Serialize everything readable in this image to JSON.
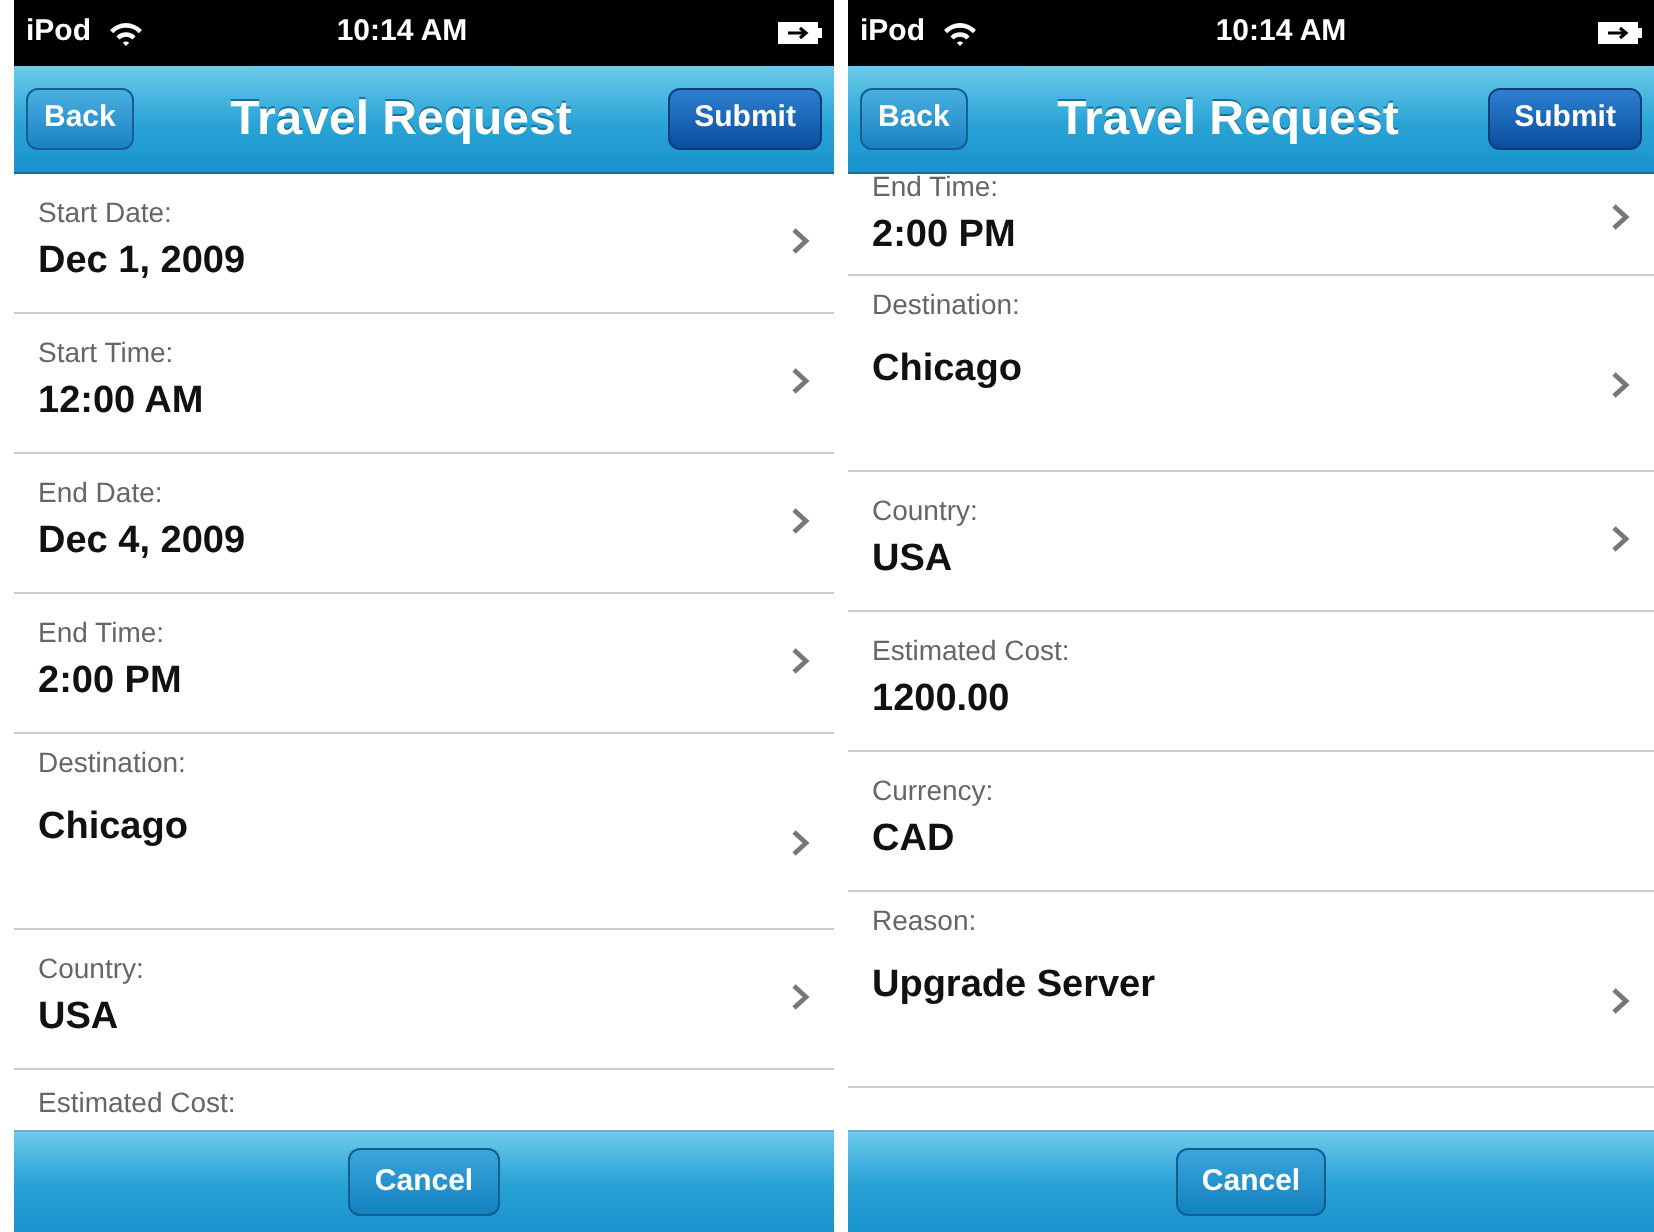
{
  "screens": [
    {
      "status": {
        "carrier": "iPod",
        "time": "10:14 AM"
      },
      "nav": {
        "back": "Back",
        "title": "Travel Request",
        "submit": "Submit"
      },
      "fields": [
        {
          "kind": "line",
          "label": "Start Date:",
          "value": "Dec 1, 2009",
          "chevron": true
        },
        {
          "kind": "line",
          "label": "Start Time:",
          "value": "12:00 AM",
          "chevron": true
        },
        {
          "kind": "line",
          "label": "End Date:",
          "value": "Dec 4, 2009",
          "chevron": true
        },
        {
          "kind": "line",
          "label": "End Time:",
          "value": "2:00 PM",
          "chevron": true
        },
        {
          "kind": "area",
          "label": "Destination:",
          "value": "Chicago",
          "chevron": true
        },
        {
          "kind": "line",
          "label": "Country:",
          "value": "USA",
          "chevron": true
        },
        {
          "kind": "line",
          "label": "Estimated Cost:"
        }
      ],
      "cancel": "Cancel"
    },
    {
      "status": {
        "carrier": "iPod",
        "time": "10:14 AM"
      },
      "nav": {
        "back": "Back",
        "title": "Travel Request",
        "submit": "Submit"
      },
      "fields": [
        {
          "kind": "top",
          "label": "End Time:",
          "value": "2:00 PM",
          "chevron": true
        },
        {
          "kind": "area",
          "label": "Destination:",
          "value": "Chicago",
          "chevron": true
        },
        {
          "kind": "line",
          "label": "Country:",
          "value": "USA",
          "chevron": true
        },
        {
          "kind": "line",
          "label": "Estimated Cost:",
          "value": "1200.00",
          "chevron": false
        },
        {
          "kind": "line",
          "label": "Currency:",
          "value": "CAD",
          "chevron": false
        },
        {
          "kind": "area",
          "label": "Reason:",
          "value": "Upgrade Server",
          "chevron": true
        }
      ],
      "cancel": "Cancel"
    }
  ]
}
